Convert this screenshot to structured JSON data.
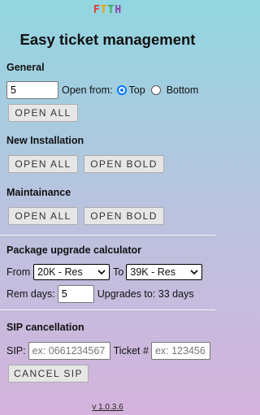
{
  "logo": {
    "letters": [
      "F",
      "T",
      "T",
      "H"
    ],
    "colors": [
      "#e53935",
      "#f4a300",
      "#3ba55c",
      "#8e44ad"
    ]
  },
  "title": "Easy ticket management",
  "general": {
    "heading": "General",
    "count_value": "5",
    "open_from_label": "Open from:",
    "options": [
      "Top",
      "Bottom"
    ],
    "selected": "Top",
    "open_all_label": "OPEN ALL"
  },
  "new_installation": {
    "heading": "New Installation",
    "open_all_label": "OPEN ALL",
    "open_bold_label": "OPEN BOLD"
  },
  "maintenance": {
    "heading": "Maintainance",
    "open_all_label": "OPEN ALL",
    "open_bold_label": "OPEN BOLD"
  },
  "calculator": {
    "heading": "Package upgrade calculator",
    "from_label": "From",
    "from_value": "20K - Res",
    "to_label": "To",
    "to_value": "39K - Res",
    "rem_days_label": "Rem days:",
    "rem_days_value": "5",
    "upgrades_text": "Upgrades to: 33 days"
  },
  "sip": {
    "heading": "SIP cancellation",
    "sip_label": "SIP:",
    "sip_placeholder": "ex: 0661234567",
    "ticket_label": "Ticket #",
    "ticket_placeholder": "ex: 123456",
    "cancel_label": "CANCEL SIP"
  },
  "version": "v 1.0.3.6"
}
